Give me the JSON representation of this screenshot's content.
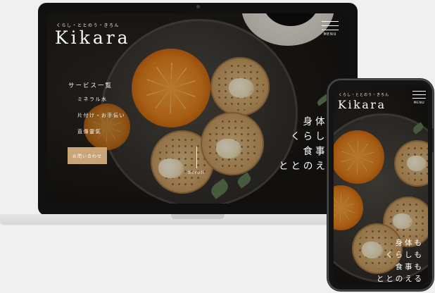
{
  "site": {
    "tagline": "くらし・ととのう・きろん",
    "logo": "Kikara",
    "menu_label": "MENU"
  },
  "desktop": {
    "nav": {
      "heading": "サービス一覧",
      "items": [
        "ミネラル水",
        "片付け・お手伝い",
        "直傳靈氣"
      ]
    },
    "contact_label": "お問い合わせ",
    "scroll_label": "Scroll",
    "catch_lines": [
      "身体も",
      "くらしも",
      "食事も",
      "ととのえる"
    ]
  },
  "mobile": {
    "catch_lines": [
      "身体も",
      "くらしも",
      "食事も",
      "ととのえる"
    ]
  },
  "colors": {
    "accent_button": "#c8a476",
    "laptop_frame": "#111111",
    "background": "#f0f0f0"
  },
  "icons": {
    "menu": "hamburger-icon"
  }
}
